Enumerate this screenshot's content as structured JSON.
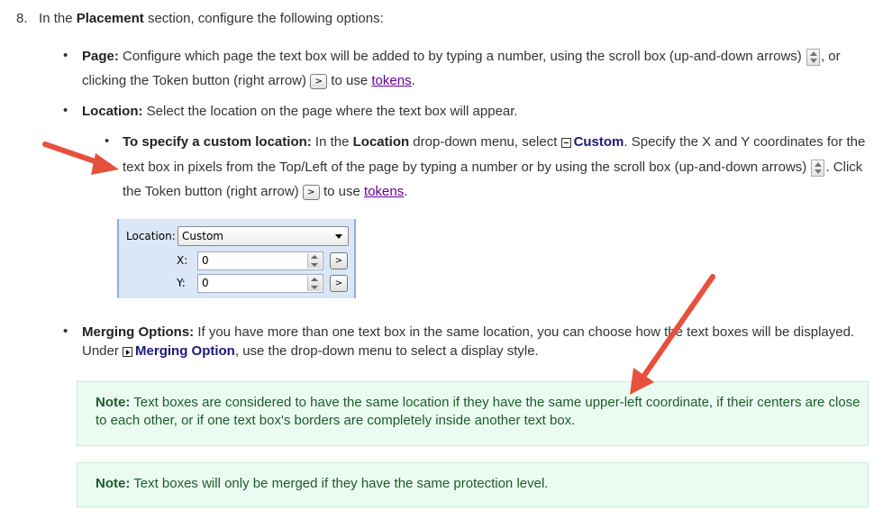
{
  "step": {
    "number": "8.",
    "pre": "In the ",
    "bold": "Placement",
    "post": " section, configure the following options:"
  },
  "page_item": {
    "label": "Page:",
    "line1_text": " Configure which page the text box will be added to by typing a number, using the scroll box (up-and-down arrows) ",
    "line1_end": ", or",
    "line2_text": "clicking the Token button (right arrow) ",
    "line2_mid": " to use ",
    "link": "tokens",
    "end": "."
  },
  "location_item": {
    "label": "Location:",
    "text": " Select the location on the page where the text box will appear."
  },
  "custom_item": {
    "label": "To specify a custom location:",
    "l1_a": " In the ",
    "l1_bold": "Location",
    "l1_b": " drop-down menu, select ",
    "l1_custom": "Custom",
    "l1_c": ". Specify the X and Y coordinates for the",
    "l2_a": "text box in pixels from the Top/Left of the page by typing a number or by using the scroll box (up-and-down arrows) ",
    "l2_b": ". Click",
    "l3_a": "the Token button (right arrow) ",
    "l3_b": " to use ",
    "link": "tokens",
    "end": "."
  },
  "dialog": {
    "location_label": "Location:",
    "location_value": "Custom",
    "x_label": "X:",
    "x_value": "0",
    "y_label": "Y:",
    "y_value": "0",
    "token_glyph": ">"
  },
  "token_glyph": ">",
  "merging_item": {
    "label": "Merging Options:",
    "l1": " If you have more than one text box in the same location, you can choose how the text boxes will be displayed.",
    "l2_a": "Under ",
    "l2_bold": "Merging Option",
    "l2_b": ", use the drop-down menu to select a display style."
  },
  "note1": {
    "label": "Note:",
    "l1": " Text boxes are considered to have the same location if they have the same upper-left coordinate, if their centers are close",
    "l2": "to each other, or if one text box's borders are completely inside another text box."
  },
  "note2": {
    "label": "Note:",
    "text": " Text boxes will only be merged if they have the same protection level."
  },
  "colors": {
    "arrow": "#e8503e",
    "note_bg": "#eafcf2",
    "note_text": "#1e5a2a",
    "link": "#660099",
    "section_link": "#1a1a7a"
  }
}
